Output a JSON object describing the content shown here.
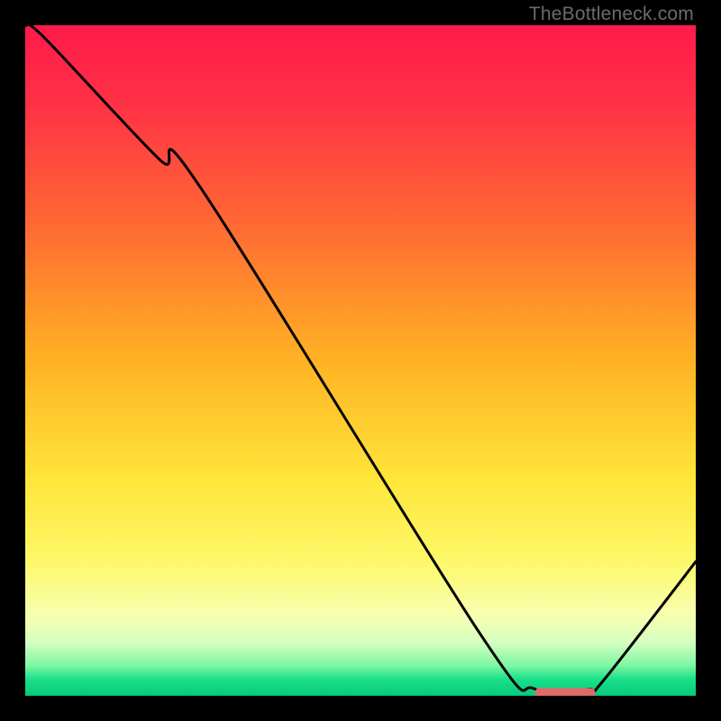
{
  "watermark": "TheBottleneck.com",
  "chart_data": {
    "type": "line",
    "title": "",
    "xlabel": "",
    "ylabel": "",
    "xlim": [
      0,
      100
    ],
    "ylim": [
      0,
      100
    ],
    "series": [
      {
        "name": "curve",
        "x": [
          0,
          3,
          20,
          26,
          68,
          76,
          84,
          86,
          100
        ],
        "y": [
          100,
          98,
          80,
          76,
          9,
          1,
          1,
          2,
          20
        ]
      }
    ],
    "marker_segment": {
      "x0": 76,
      "x1": 85,
      "y": 1
    },
    "gradient_stops": [
      {
        "offset": 0.0,
        "color": "#ff1a4b"
      },
      {
        "offset": 0.12,
        "color": "#ff3245"
      },
      {
        "offset": 0.3,
        "color": "#ff6a33"
      },
      {
        "offset": 0.5,
        "color": "#ffb224"
      },
      {
        "offset": 0.68,
        "color": "#ffe63a"
      },
      {
        "offset": 0.8,
        "color": "#fdf86a"
      },
      {
        "offset": 0.88,
        "color": "#f8ffb0"
      },
      {
        "offset": 0.92,
        "color": "#d6ffc0"
      },
      {
        "offset": 0.955,
        "color": "#7cf7a3"
      },
      {
        "offset": 0.975,
        "color": "#1be08a"
      },
      {
        "offset": 1.0,
        "color": "#08c97c"
      }
    ]
  }
}
